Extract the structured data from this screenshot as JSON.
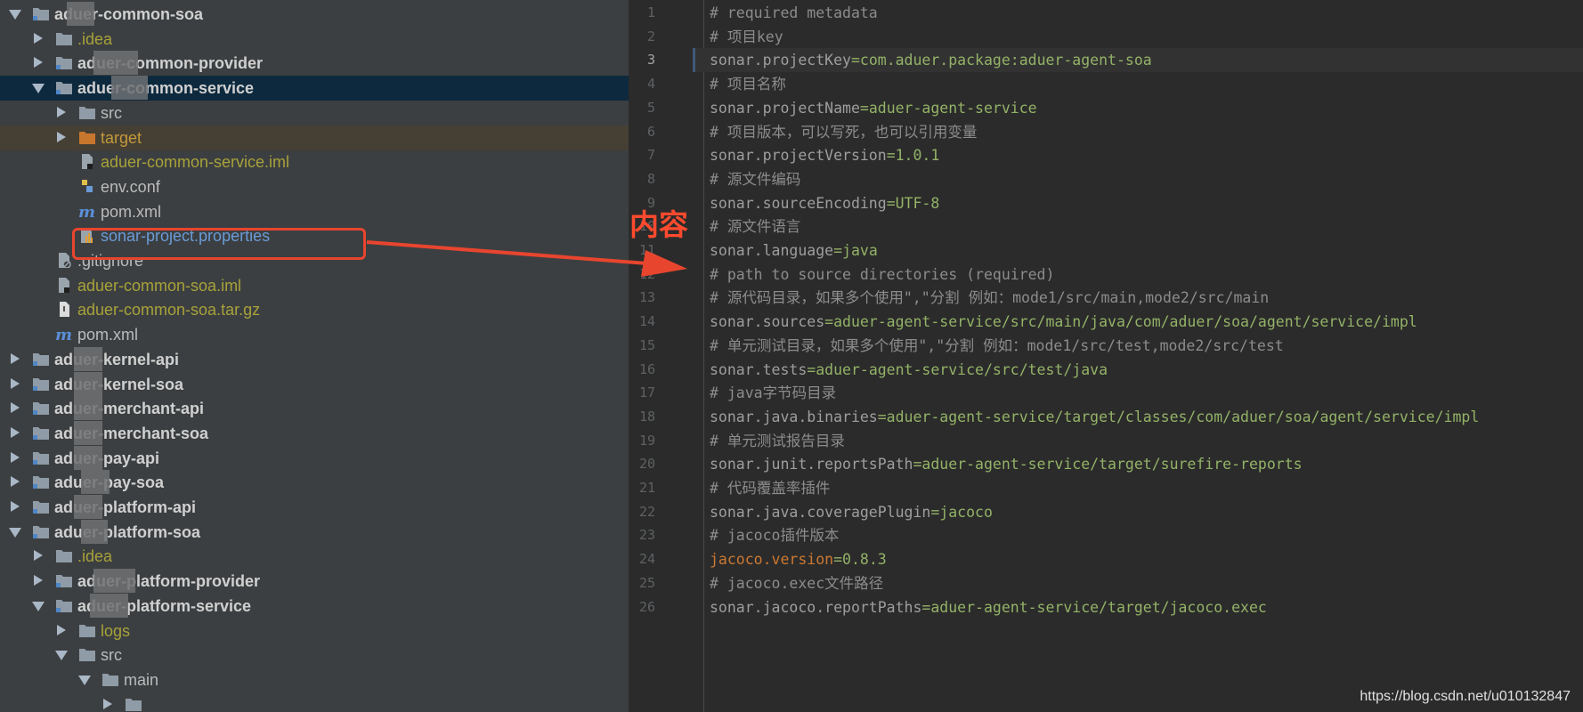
{
  "tree": [
    {
      "depth": 0,
      "arrow": "e",
      "icon": "module-folder",
      "label": "aduer-common-soa",
      "style": "b",
      "blur": [
        68,
        14
      ]
    },
    {
      "depth": 1,
      "arrow": "c",
      "icon": "folder",
      "label": ".idea",
      "style": "y"
    },
    {
      "depth": 1,
      "arrow": "c",
      "icon": "module-folder",
      "label": "aduer-common-provider",
      "style": "b",
      "blur": [
        110,
        18
      ]
    },
    {
      "depth": 1,
      "arrow": "e",
      "icon": "module-folder",
      "label": "aduer-common-service",
      "style": "b",
      "selected": true,
      "blur": [
        90,
        38
      ]
    },
    {
      "depth": 2,
      "arrow": "c",
      "icon": "folder",
      "label": "src",
      "style": ""
    },
    {
      "depth": 2,
      "arrow": "c",
      "icon": "orange-folder",
      "label": "target",
      "style": "o",
      "target": true
    },
    {
      "depth": 2,
      "arrow": "",
      "icon": "iml-file",
      "label": "aduer-common-service.iml",
      "style": "y"
    },
    {
      "depth": 2,
      "arrow": "",
      "icon": "conf-file",
      "label": "env.conf",
      "style": ""
    },
    {
      "depth": 2,
      "arrow": "",
      "icon": "maven-file",
      "label": "pom.xml",
      "style": ""
    },
    {
      "depth": 2,
      "arrow": "",
      "icon": "properties-file",
      "label": "sonar-project.properties",
      "style": "bl"
    },
    {
      "depth": 1,
      "arrow": "",
      "icon": "gitignore-file",
      "label": ".gitignore",
      "style": ""
    },
    {
      "depth": 1,
      "arrow": "",
      "icon": "iml-file",
      "label": "aduer-common-soa.iml",
      "style": "y"
    },
    {
      "depth": 1,
      "arrow": "",
      "icon": "archive-file",
      "label": "aduer-common-soa.tar.gz",
      "style": "y"
    },
    {
      "depth": 1,
      "arrow": "",
      "icon": "maven-file",
      "label": "pom.xml",
      "style": ""
    },
    {
      "depth": 0,
      "arrow": "c",
      "icon": "module-folder",
      "label": "aduer-kernel-api",
      "style": "b",
      "blur": [
        70,
        22
      ]
    },
    {
      "depth": 0,
      "arrow": "c",
      "icon": "module-folder",
      "label": "aduer-kernel-soa",
      "style": "b",
      "blur": [
        70,
        22
      ]
    },
    {
      "depth": 0,
      "arrow": "c",
      "icon": "module-folder",
      "label": "aduer-merchant-api",
      "style": "b",
      "blur": [
        70,
        22
      ]
    },
    {
      "depth": 0,
      "arrow": "c",
      "icon": "module-folder",
      "label": "aduer-merchant-soa",
      "style": "b",
      "blur": [
        70,
        22
      ]
    },
    {
      "depth": 0,
      "arrow": "c",
      "icon": "module-folder",
      "label": "aduer-pay-api",
      "style": "b",
      "blur": [
        70,
        22
      ]
    },
    {
      "depth": 0,
      "arrow": "c",
      "icon": "module-folder",
      "label": "aduer-pay-soa",
      "style": "b",
      "blur": [
        70,
        30
      ]
    },
    {
      "depth": 0,
      "arrow": "c",
      "icon": "module-folder",
      "label": "aduer-platform-api",
      "style": "b",
      "blur": [
        70,
        22
      ]
    },
    {
      "depth": 0,
      "arrow": "e",
      "icon": "module-folder",
      "label": "aduer-platform-soa",
      "style": "b",
      "blur": [
        66,
        30
      ]
    },
    {
      "depth": 1,
      "arrow": "c",
      "icon": "folder",
      "label": ".idea",
      "style": "y"
    },
    {
      "depth": 1,
      "arrow": "c",
      "icon": "module-folder",
      "label": "aduer-platform-provider",
      "style": "b",
      "blur": [
        104,
        18
      ]
    },
    {
      "depth": 1,
      "arrow": "e",
      "icon": "module-folder",
      "label": "aduer-platform-service",
      "style": "b",
      "blur": [
        96,
        14
      ]
    },
    {
      "depth": 2,
      "arrow": "c",
      "icon": "folder",
      "label": "logs",
      "style": "y"
    },
    {
      "depth": 2,
      "arrow": "e",
      "icon": "folder",
      "label": "src",
      "style": ""
    },
    {
      "depth": 3,
      "arrow": "e",
      "icon": "folder",
      "label": "main",
      "style": ""
    },
    {
      "depth": 4,
      "arrow": "c",
      "icon": "folder",
      "label": "",
      "style": ""
    }
  ],
  "editor": {
    "current_line": 3,
    "lines": [
      [
        [
          "cm",
          "# required metadata"
        ]
      ],
      [
        [
          "cm",
          "# 项目key"
        ]
      ],
      [
        [
          "k",
          "sonar.projectKey"
        ],
        [
          "v",
          "=com.aduer.package:aduer-agent-soa"
        ]
      ],
      [
        [
          "cm",
          "# 项目名称"
        ]
      ],
      [
        [
          "k",
          "sonar.projectName"
        ],
        [
          "v",
          "=aduer-agent-service"
        ]
      ],
      [
        [
          "cm",
          "# 项目版本，可以写死，也可以引用变量"
        ]
      ],
      [
        [
          "k",
          "sonar.projectVersion"
        ],
        [
          "v",
          "=1.0.1"
        ]
      ],
      [
        [
          "cm",
          "# 源文件编码"
        ]
      ],
      [
        [
          "k",
          "sonar.sourceEncoding"
        ],
        [
          "v",
          "=UTF-8"
        ]
      ],
      [
        [
          "cm",
          "# 源文件语言"
        ]
      ],
      [
        [
          "k",
          "sonar.language"
        ],
        [
          "v",
          "=java"
        ]
      ],
      [
        [
          "cm",
          "# path to source directories (required)"
        ]
      ],
      [
        [
          "cm",
          "# 源代码目录，如果多个使用\",\"分割 例如：mode1/src/main,mode2/src/main"
        ]
      ],
      [
        [
          "k",
          "sonar.sources"
        ],
        [
          "v",
          "=aduer-agent-service/src/main/java/com/aduer/soa/agent/service/impl"
        ]
      ],
      [
        [
          "cm",
          "# 单元测试目录，如果多个使用\",\"分割 例如：mode1/src/test,mode2/src/test"
        ]
      ],
      [
        [
          "k",
          "sonar.tests"
        ],
        [
          "v",
          "=aduer-agent-service/src/test/java"
        ]
      ],
      [
        [
          "cm",
          "# java字节码目录"
        ]
      ],
      [
        [
          "k",
          "sonar.java.binaries"
        ],
        [
          "v",
          "=aduer-agent-service/target/classes/com/aduer/soa/agent/service/impl"
        ]
      ],
      [
        [
          "cm",
          "# 单元测试报告目录"
        ]
      ],
      [
        [
          "k",
          "sonar.junit.reportsPath"
        ],
        [
          "v",
          "=aduer-agent-service/target/surefire-reports"
        ]
      ],
      [
        [
          "cm",
          "# 代码覆盖率插件"
        ]
      ],
      [
        [
          "k",
          "sonar.java.coveragePlugin"
        ],
        [
          "v",
          "=jacoco"
        ]
      ],
      [
        [
          "cm",
          "# jacoco插件版本"
        ]
      ],
      [
        [
          "kj",
          "jacoco.version"
        ],
        [
          "v",
          "=0.8.3"
        ]
      ],
      [
        [
          "cm",
          "# jacoco.exec文件路径"
        ]
      ],
      [
        [
          "k",
          "sonar.jacoco.reportPaths"
        ],
        [
          "v",
          "=aduer-agent-service/target/jacoco.exec"
        ]
      ]
    ]
  },
  "annotation": {
    "note": "内容",
    "color": "#e8452f"
  },
  "watermark": "https://blog.csdn.net/u010132847"
}
